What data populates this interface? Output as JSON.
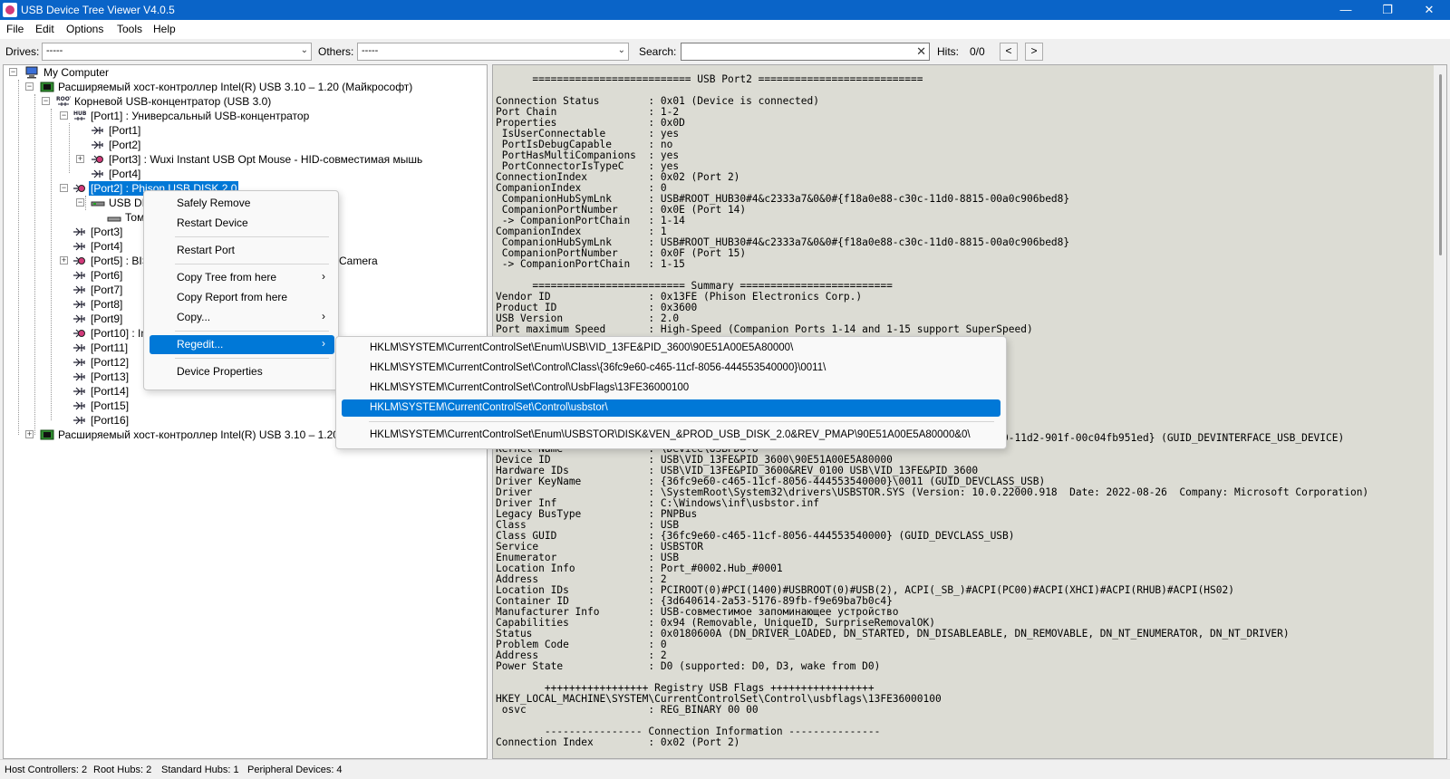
{
  "window": {
    "title": "USB Device Tree Viewer V4.0.5"
  },
  "menubar": {
    "items": [
      "File",
      "Edit",
      "Options",
      "Tools",
      "Help"
    ]
  },
  "toolbar": {
    "drives_label": "Drives:",
    "drives_value": "-----",
    "others_label": "Others:",
    "others_value": "-----",
    "search_label": "Search:",
    "search_value": "",
    "hits_label": "Hits:",
    "hits_value": "0/0",
    "prev": "<",
    "next": ">"
  },
  "tree": {
    "nodes": [
      "My Computer",
      "Расширяемый хост-контроллер Intel(R) USB 3.10 – 1.20 (Майкрософт)",
      "Корневой USB-концентратор (USB 3.0)",
      "[Port1] : Универсальный USB-концентратор",
      "[Port1]",
      "[Port2]",
      "[Port3] : Wuxi Instant USB Opt Mouse - HID-совместимая мышь",
      "[Port4]",
      "[Port2] : Phison USB DISK 2.0",
      "USB DI",
      "Том",
      "[Port3]",
      "[Port4]",
      "[Port5] : BIS",
      "[Port6]",
      "[Port7]",
      "[Port8]",
      "[Port9]",
      "[Port10] : Int",
      "[Port11]",
      "[Port12]",
      "[Port13]",
      "[Port14]",
      "[Port15]",
      "[Port16]",
      "Расширяемый хост-контроллер Intel(R) USB 3.10 – 1.20 (Май"
    ],
    "camera_fragment": "Camera"
  },
  "report": {
    "lines": [
      "      ========================== USB Port2 ===========================",
      "",
      "Connection Status        : 0x01 (Device is connected)",
      "Port Chain               : 1-2",
      "Properties               : 0x0D",
      " IsUserConnectable       : yes",
      " PortIsDebugCapable      : no",
      " PortHasMultiCompanions  : yes",
      " PortConnectorIsTypeC    : yes",
      "ConnectionIndex          : 0x02 (Port 2)",
      "CompanionIndex           : 0",
      " CompanionHubSymLnk      : USB#ROOT_HUB30#4&c2333a7&0&0#{f18a0e88-c30c-11d0-8815-00a0c906bed8}",
      " CompanionPortNumber     : 0x0E (Port 14)",
      " -> CompanionPortChain   : 1-14",
      "CompanionIndex           : 1",
      " CompanionHubSymLnk      : USB#ROOT_HUB30#4&c2333a7&0&0#{f18a0e88-c30c-11d0-8815-00a0c906bed8}",
      " CompanionPortNumber     : 0x0F (Port 15)",
      " -> CompanionPortChain   : 1-15",
      "",
      "      ========================= Summary =========================",
      "Vendor ID                : 0x13FE (Phison Electronics Corp.)",
      "Product ID               : 0x3600",
      "USB Version              : 2.0",
      "Port maximum Speed       : High-Speed (Companion Ports 1-14 and 1-15 support SuperSpeed)",
      "",
      "",
      "",
      "",
      "",
      "",
      "",
      "",
      "",
      "Device Path              : \\\\?\\USB#VID_13FE&PID_3600#90E51A00E5A80000#{a5dcbf10-6530-11d2-901f-00c04fb951ed} (GUID_DEVINTERFACE_USB_DEVICE)",
      "Kernel Name              : \\Device\\USBPDO-6",
      "Device ID                : USB\\VID_13FE&PID_3600\\90E51A00E5A80000",
      "Hardware IDs             : USB\\VID_13FE&PID_3600&REV_0100 USB\\VID_13FE&PID_3600",
      "Driver KeyName           : {36fc9e60-c465-11cf-8056-444553540000}\\0011 (GUID_DEVCLASS_USB)",
      "Driver                   : \\SystemRoot\\System32\\drivers\\USBSTOR.SYS (Version: 10.0.22000.918  Date: 2022-08-26  Company: Microsoft Corporation)",
      "Driver Inf               : C:\\Windows\\inf\\usbstor.inf",
      "Legacy BusType           : PNPBus",
      "Class                    : USB",
      "Class GUID               : {36fc9e60-c465-11cf-8056-444553540000} (GUID_DEVCLASS_USB)",
      "Service                  : USBSTOR",
      "Enumerator               : USB",
      "Location Info            : Port_#0002.Hub_#0001",
      "Address                  : 2",
      "Location IDs             : PCIROOT(0)#PCI(1400)#USBROOT(0)#USB(2), ACPI(_SB_)#ACPI(PC00)#ACPI(XHCI)#ACPI(RHUB)#ACPI(HS02)",
      "Container ID             : {3d640614-2a53-5176-89fb-f9e69ba7b0c4}",
      "Manufacturer Info        : USB-совместимое запоминающее устройство",
      "Capabilities             : 0x94 (Removable, UniqueID, SurpriseRemovalOK)",
      "Status                   : 0x0180600A (DN_DRIVER_LOADED, DN_STARTED, DN_DISABLEABLE, DN_REMOVABLE, DN_NT_ENUMERATOR, DN_NT_DRIVER)",
      "Problem Code             : 0",
      "Address                  : 2",
      "Power State              : D0 (supported: D0, D3, wake from D0)",
      "",
      "        +++++++++++++++++ Registry USB Flags +++++++++++++++++",
      "HKEY_LOCAL_MACHINE\\SYSTEM\\CurrentControlSet\\Control\\usbflags\\13FE36000100",
      " osvc                    : REG_BINARY 00 00",
      "",
      "        ---------------- Connection Information ---------------",
      "Connection Index         : 0x02 (Port 2)"
    ]
  },
  "context_menu": {
    "items": [
      "Safely Remove",
      "Restart Device",
      "Restart Port",
      "Copy Tree from here",
      "Copy Report from here",
      "Copy...",
      "Regedit...",
      "Device Properties"
    ]
  },
  "regedit_submenu": {
    "items": [
      "HKLM\\SYSTEM\\CurrentControlSet\\Enum\\USB\\VID_13FE&PID_3600\\90E51A00E5A80000\\",
      "HKLM\\SYSTEM\\CurrentControlSet\\Control\\Class\\{36fc9e60-c465-11cf-8056-444553540000}\\0011\\",
      "HKLM\\SYSTEM\\CurrentControlSet\\Control\\UsbFlags\\13FE36000100",
      "HKLM\\SYSTEM\\CurrentControlSet\\Control\\usbstor\\",
      "HKLM\\SYSTEM\\CurrentControlSet\\Enum\\USBSTOR\\DISK&VEN_&PROD_USB_DISK_2.0&REV_PMAP\\90E51A00E5A80000&0\\"
    ]
  },
  "statusbar": {
    "host_controllers": "Host Controllers: 2",
    "root_hubs": "Root Hubs: 2",
    "standard_hubs": "Standard Hubs: 1",
    "peripheral_devices": "Peripheral Devices: 4"
  },
  "colors": {
    "titlebar": "#0a64c8",
    "selection": "#0078d7",
    "report_bg": "#dcdcd4"
  }
}
